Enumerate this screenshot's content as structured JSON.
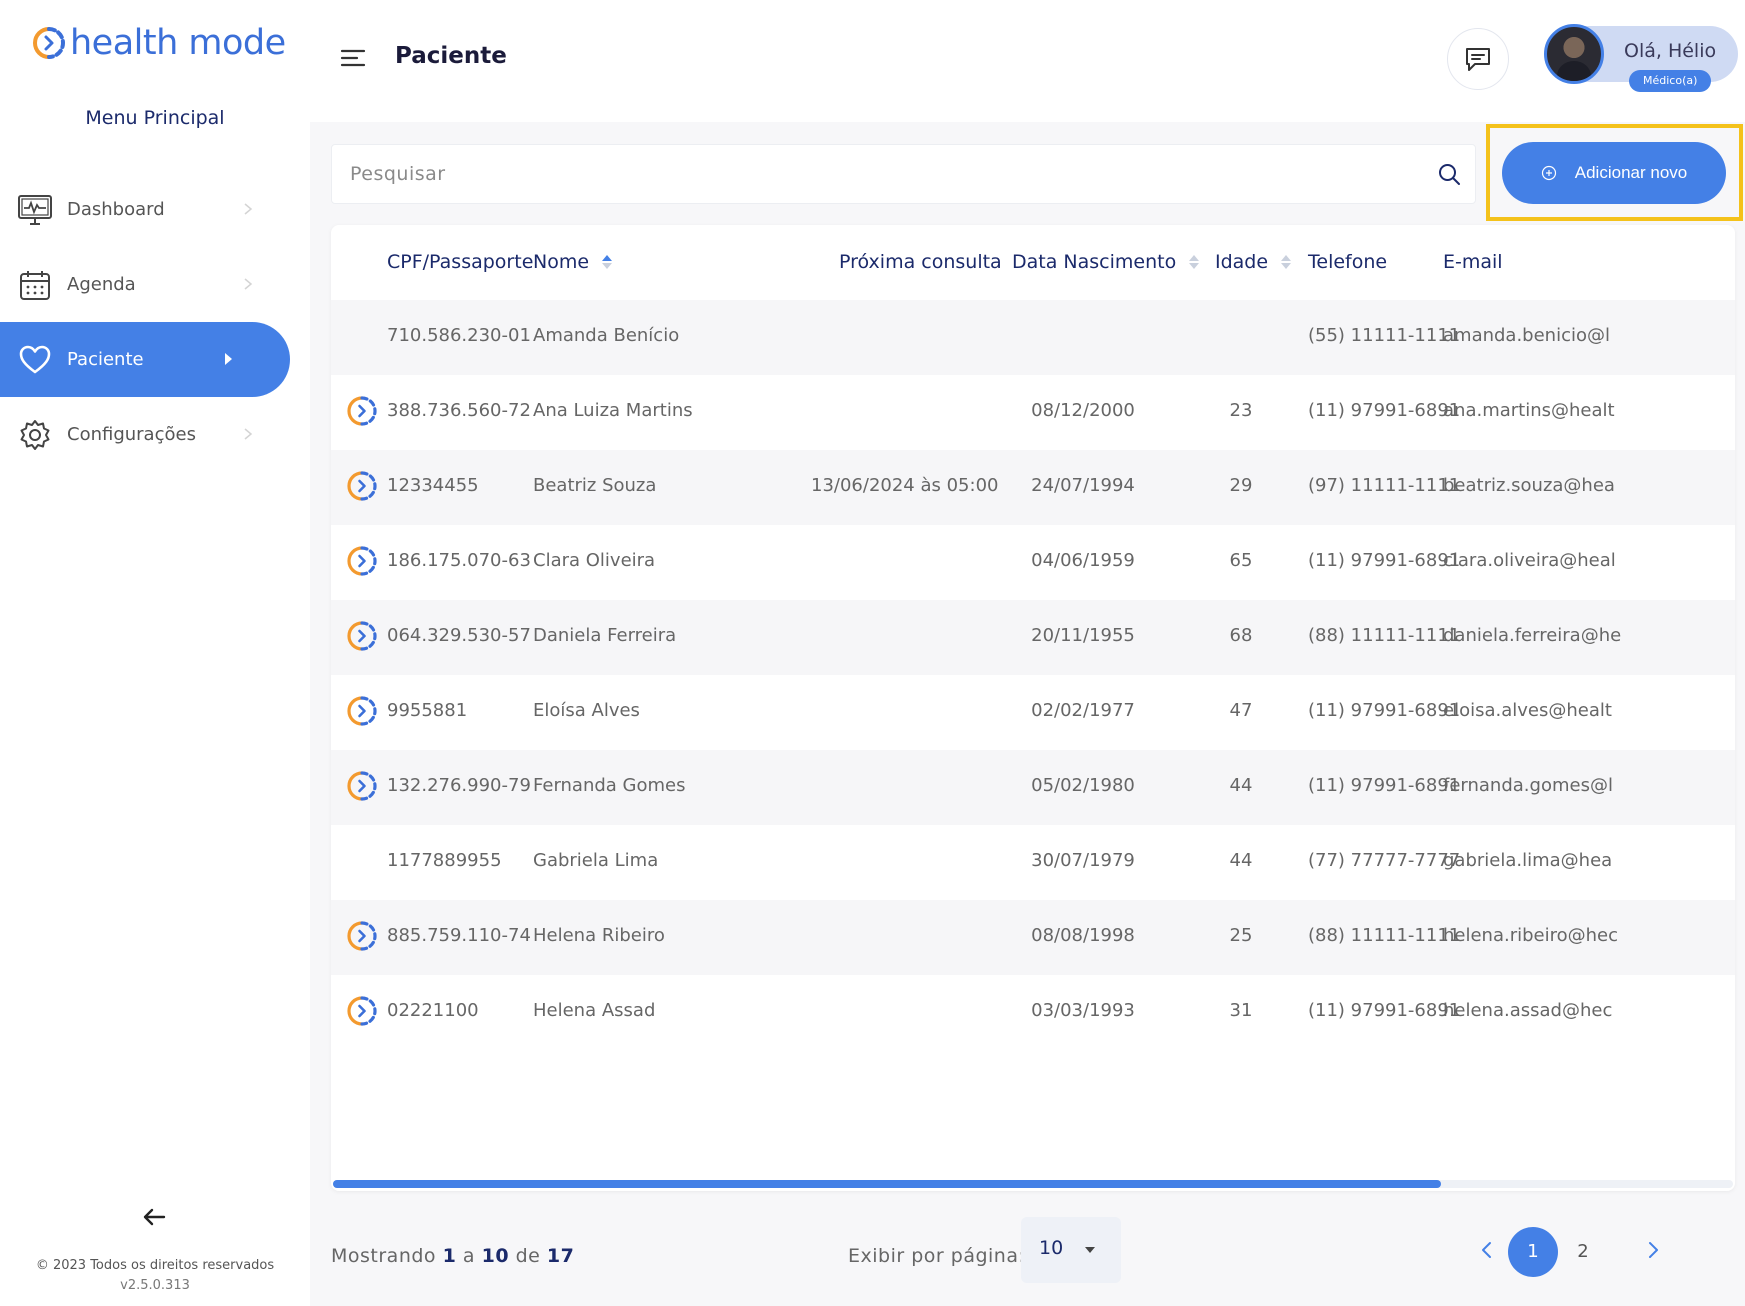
{
  "app": {
    "logo_text": "health mode"
  },
  "sidebar": {
    "menu_title": "Menu Principal",
    "items": [
      {
        "label": "Dashboard",
        "icon": "monitor-pulse-icon",
        "active": false
      },
      {
        "label": "Agenda",
        "icon": "calendar-icon",
        "active": false
      },
      {
        "label": "Paciente",
        "icon": "heart-icon",
        "active": true
      },
      {
        "label": "Configurações",
        "icon": "gear-icon",
        "active": false
      }
    ],
    "copyright": "© 2023 Todos os direitos reservados",
    "version": "v2.5.0.313"
  },
  "header": {
    "title": "Paciente",
    "greeting": "Olá, Hélio",
    "role": "Médico(a)"
  },
  "search": {
    "placeholder": "Pesquisar"
  },
  "add_button": {
    "label": "Adicionar novo"
  },
  "table": {
    "columns": [
      "CPF/Passaporte",
      "Nome",
      "Próxima consulta",
      "Data Nascimento",
      "Idade",
      "Telefone",
      "E-mail"
    ],
    "rows": [
      {
        "linked": false,
        "cpf": "710.586.230-01",
        "nome": "Amanda Benício",
        "proxima": "",
        "nascimento": "",
        "idade": "",
        "telefone": "(55) 11111-1111",
        "email": "amanda.benicio@l"
      },
      {
        "linked": true,
        "cpf": "388.736.560-72",
        "nome": "Ana Luiza Martins",
        "proxima": "",
        "nascimento": "08/12/2000",
        "idade": "23",
        "telefone": "(11) 97991-6891",
        "email": "ana.martins@healt"
      },
      {
        "linked": true,
        "cpf": "12334455",
        "nome": "Beatriz Souza",
        "proxima": "13/06/2024 às 05:00",
        "nascimento": "24/07/1994",
        "idade": "29",
        "telefone": "(97) 11111-1111",
        "email": "beatriz.souza@hea"
      },
      {
        "linked": true,
        "cpf": "186.175.070-63",
        "nome": "Clara Oliveira",
        "proxima": "",
        "nascimento": "04/06/1959",
        "idade": "65",
        "telefone": "(11) 97991-6891",
        "email": "clara.oliveira@heal"
      },
      {
        "linked": true,
        "cpf": "064.329.530-57",
        "nome": "Daniela Ferreira",
        "proxima": "",
        "nascimento": "20/11/1955",
        "idade": "68",
        "telefone": "(88) 11111-1111",
        "email": "daniela.ferreira@he"
      },
      {
        "linked": true,
        "cpf": "9955881",
        "nome": "Eloísa Alves",
        "proxima": "",
        "nascimento": "02/02/1977",
        "idade": "47",
        "telefone": "(11) 97991-6891",
        "email": "eloisa.alves@healt"
      },
      {
        "linked": true,
        "cpf": "132.276.990-79",
        "nome": "Fernanda Gomes",
        "proxima": "",
        "nascimento": "05/02/1980",
        "idade": "44",
        "telefone": "(11) 97991-6891",
        "email": "fernanda.gomes@l"
      },
      {
        "linked": false,
        "cpf": "1177889955",
        "nome": "Gabriela Lima",
        "proxima": "",
        "nascimento": "30/07/1979",
        "idade": "44",
        "telefone": "(77) 77777-7777",
        "email": "gabriela.lima@hea"
      },
      {
        "linked": true,
        "cpf": "885.759.110-74",
        "nome": "Helena Ribeiro",
        "proxima": "",
        "nascimento": "08/08/1998",
        "idade": "25",
        "telefone": "(88) 11111-1111",
        "email": "helena.ribeiro@hec"
      },
      {
        "linked": true,
        "cpf": "02221100",
        "nome": "Helena Assad",
        "proxima": "",
        "nascimento": "03/03/1993",
        "idade": "31",
        "telefone": "(11) 97991-6891",
        "email": "helena.assad@hec"
      }
    ]
  },
  "pagination": {
    "showing_prefix": "Mostrando",
    "from": "1",
    "to_word": "a",
    "to": "10",
    "of_word": "de",
    "total": "17",
    "per_page_label": "Exibir por página:",
    "per_page": "10",
    "pages": [
      "1",
      "2"
    ],
    "current_page": "1"
  },
  "colors": {
    "accent": "#4480e6",
    "highlight": "#f4c21b",
    "heading": "#1b2a6b",
    "logo_orange": "#f39a2f"
  }
}
